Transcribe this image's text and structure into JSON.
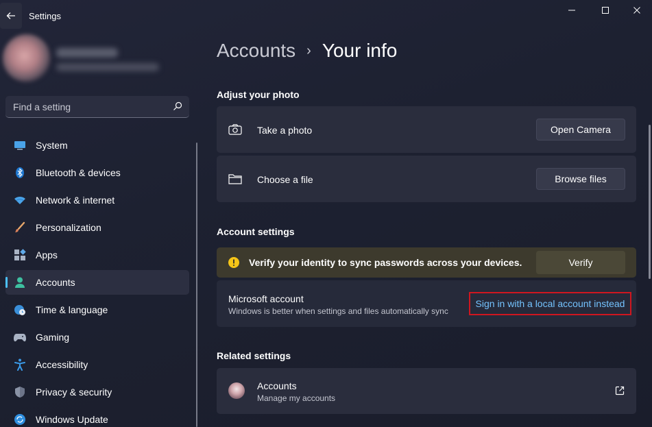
{
  "window": {
    "title": "Settings"
  },
  "sidebar": {
    "search_placeholder": "Find a setting",
    "items": [
      {
        "label": "System",
        "icon": "monitor-icon"
      },
      {
        "label": "Bluetooth & devices",
        "icon": "bluetooth-icon"
      },
      {
        "label": "Network & internet",
        "icon": "wifi-icon"
      },
      {
        "label": "Personalization",
        "icon": "brush-icon"
      },
      {
        "label": "Apps",
        "icon": "apps-icon"
      },
      {
        "label": "Accounts",
        "icon": "person-icon",
        "active": true
      },
      {
        "label": "Time & language",
        "icon": "globe-clock-icon"
      },
      {
        "label": "Gaming",
        "icon": "gamepad-icon"
      },
      {
        "label": "Accessibility",
        "icon": "accessibility-icon"
      },
      {
        "label": "Privacy & security",
        "icon": "shield-icon"
      },
      {
        "label": "Windows Update",
        "icon": "update-icon"
      }
    ]
  },
  "main": {
    "breadcrumb": {
      "parent": "Accounts",
      "separator": "›",
      "current": "Your info"
    },
    "adjust_photo": {
      "title": "Adjust your photo",
      "take_photo": {
        "label": "Take a photo",
        "button": "Open Camera",
        "icon": "camera-icon"
      },
      "choose_file": {
        "label": "Choose a file",
        "button": "Browse files",
        "icon": "folder-icon"
      }
    },
    "account_settings": {
      "title": "Account settings",
      "warning": {
        "text": "Verify your identity to sync passwords across your devices.",
        "button": "Verify",
        "icon": "warning-icon"
      },
      "microsoft_account": {
        "title": "Microsoft account",
        "subtitle": "Windows is better when settings and files automatically sync",
        "link": "Sign in with a local account instead"
      }
    },
    "related_settings": {
      "title": "Related settings",
      "accounts": {
        "title": "Accounts",
        "subtitle": "Manage my accounts",
        "icon": "external-link-icon"
      }
    }
  },
  "colors": {
    "accent": "#4cc2ff",
    "link": "#74c3ff",
    "warning": "#f5c518",
    "highlight_border": "#d0161f"
  }
}
